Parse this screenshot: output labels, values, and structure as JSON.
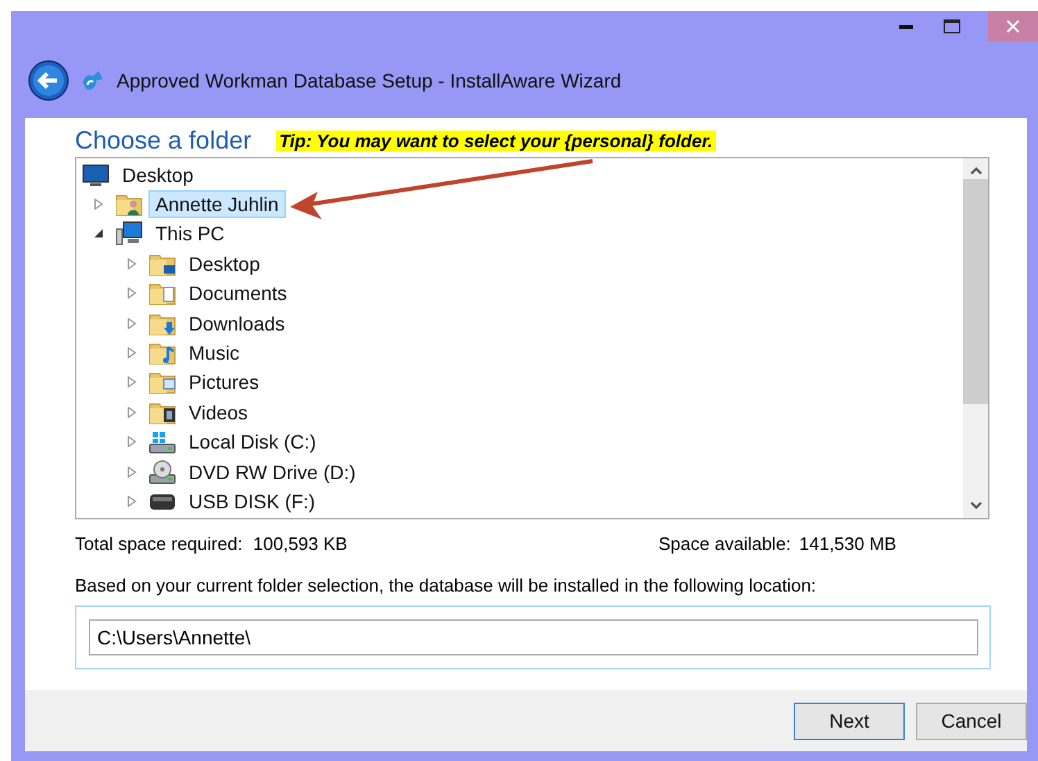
{
  "window": {
    "title": "Approved Workman Database Setup - InstallAware Wizard"
  },
  "page": {
    "heading": "Choose a folder",
    "tip": "Tip: You may want to select your {personal} folder."
  },
  "tree": {
    "items": [
      {
        "label": "Desktop",
        "kind": "monitor",
        "selected": false,
        "children": [
          {
            "label": "Annette Juhlin",
            "kind": "user-folder",
            "selected": true,
            "expanded": false
          },
          {
            "label": "This PC",
            "kind": "computer",
            "selected": false,
            "expanded": true,
            "children": [
              {
                "label": "Desktop",
                "kind": "folder-desktop",
                "selected": false,
                "expanded": false
              },
              {
                "label": "Documents",
                "kind": "folder-documents",
                "selected": false,
                "expanded": false
              },
              {
                "label": "Downloads",
                "kind": "folder-downloads",
                "selected": false,
                "expanded": false
              },
              {
                "label": "Music",
                "kind": "folder-music",
                "selected": false,
                "expanded": false
              },
              {
                "label": "Pictures",
                "kind": "folder-pictures",
                "selected": false,
                "expanded": false
              },
              {
                "label": "Videos",
                "kind": "folder-videos",
                "selected": false,
                "expanded": false
              },
              {
                "label": "Local Disk (C:)",
                "kind": "drive",
                "selected": false,
                "expanded": false
              },
              {
                "label": "DVD RW Drive (D:)",
                "kind": "disc-drive",
                "selected": false,
                "expanded": false
              },
              {
                "label": "USB DISK (F:)",
                "kind": "usb-drive",
                "selected": false,
                "expanded": false
              }
            ]
          }
        ]
      }
    ]
  },
  "space": {
    "required_label": "Total space required:",
    "required": "100,593 KB",
    "available_label": "Space available:",
    "available": "141,530 MB"
  },
  "location": {
    "description": "Based on your current folder selection, the database will be installed in the following location:",
    "path": "C:\\Users\\Annette\\"
  },
  "buttons": [
    {
      "label": "Next",
      "default": true
    },
    {
      "label": "Cancel",
      "default": false
    }
  ]
}
